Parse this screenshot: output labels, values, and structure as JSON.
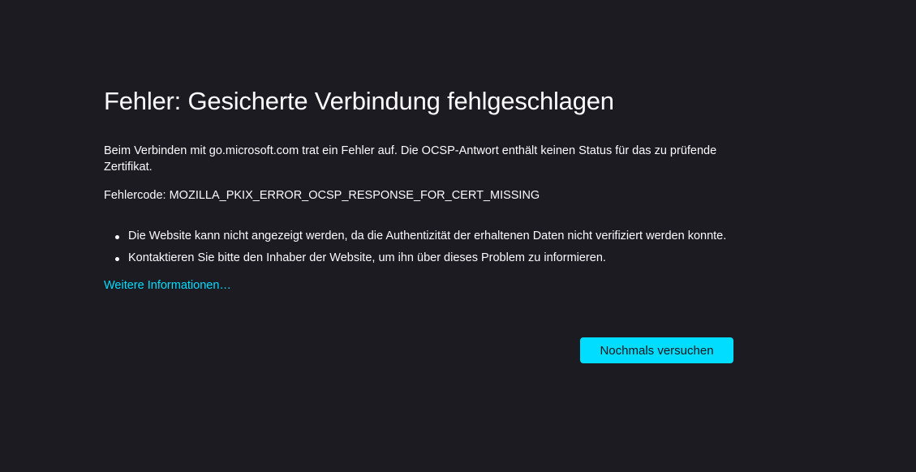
{
  "error_page": {
    "title": "Fehler: Gesicherte Verbindung fehlgeschlagen",
    "short_description": "Beim Verbinden mit go.microsoft.com trat ein Fehler auf. Die OCSP-Antwort enthält keinen Status für das zu prüfende Zertifikat.",
    "error_code": "Fehlercode: MOZILLA_PKIX_ERROR_OCSP_RESPONSE_FOR_CERT_MISSING",
    "reasons": [
      "Die Website kann nicht angezeigt werden, da die Authentizität der erhaltenen Daten nicht verifiziert werden konnte.",
      "Kontaktieren Sie bitte den Inhaber der Website, um ihn über dieses Problem zu informieren."
    ],
    "learn_more_label": "Weitere Informationen…",
    "try_again_label": "Nochmals versuchen"
  },
  "colors": {
    "background": "#1c1b22",
    "text": "#fbfbfe",
    "accent": "#00ddff",
    "button_text": "#15141a"
  }
}
